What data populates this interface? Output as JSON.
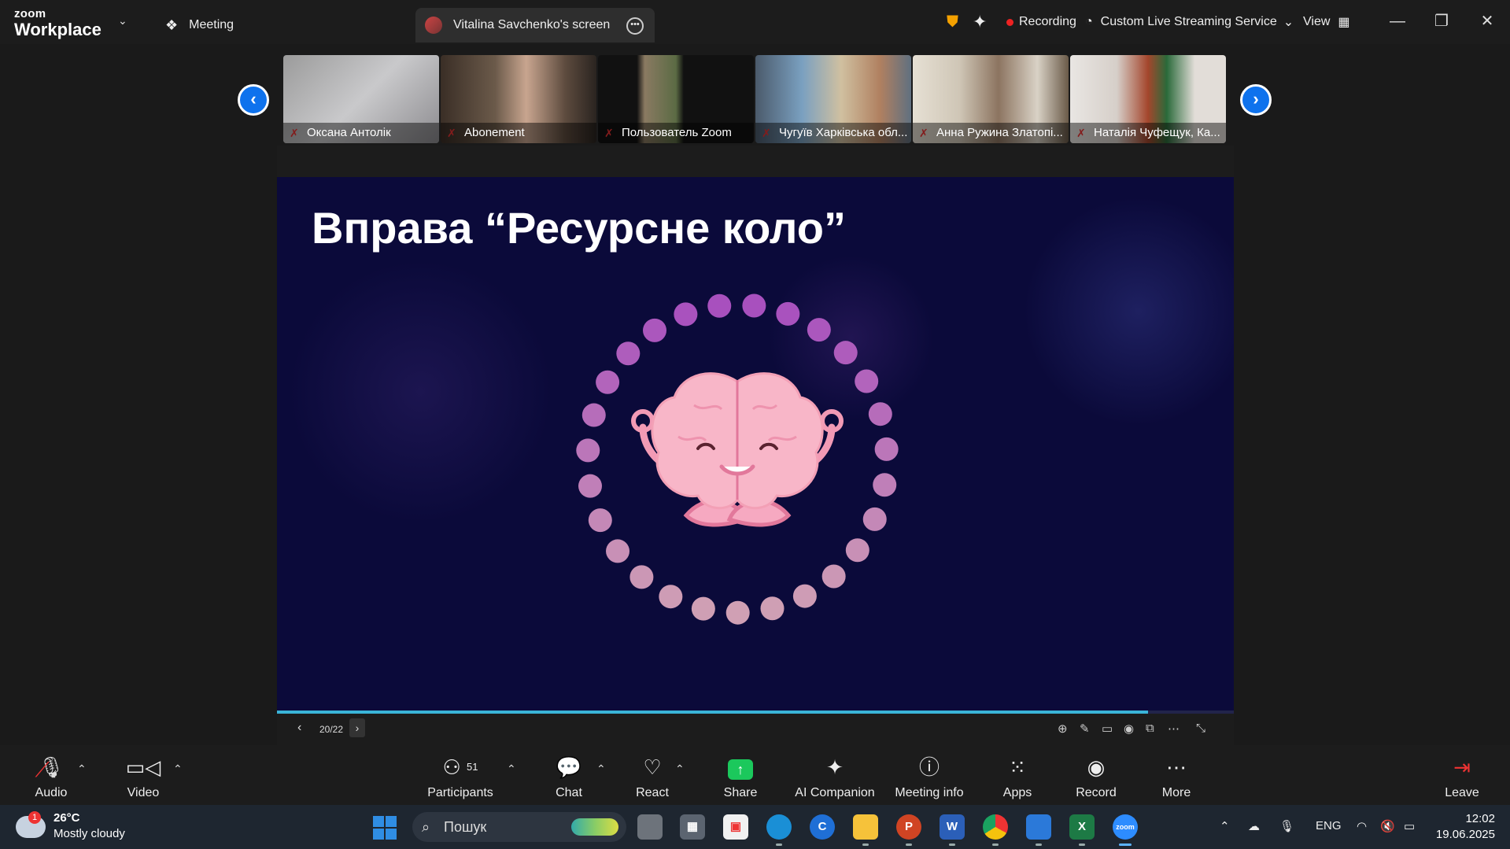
{
  "titlebar": {
    "logo_line1": "zoom",
    "logo_line2": "Workplace",
    "meeting_tab": "Meeting",
    "screen_tab": "Vitalina Savchenko's screen",
    "recording": "Recording",
    "streaming": "Custom Live Streaming Service",
    "view": "View"
  },
  "participants_strip": [
    {
      "name": "Оксана Антолік"
    },
    {
      "name": "Abonement"
    },
    {
      "name": "Пользователь Zoom"
    },
    {
      "name": "Чугуїв Харківська обл..."
    },
    {
      "name": "Анна Ружина Златопі..."
    },
    {
      "name": "Наталія Чуфещук, Ка..."
    }
  ],
  "slide": {
    "title": "Вправа “Ресурсне коло”",
    "page": "20/22",
    "progress": 0.91
  },
  "toolbar": {
    "audio": "Audio",
    "video": "Video",
    "participants": "Participants",
    "participants_count": "51",
    "chat": "Chat",
    "react": "React",
    "share": "Share",
    "ai": "AI Companion",
    "info": "Meeting info",
    "apps": "Apps",
    "record": "Record",
    "more": "More",
    "leave": "Leave"
  },
  "taskbar": {
    "temp": "26°C",
    "weather": "Mostly cloudy",
    "weather_badge": "1",
    "search": "Пошук",
    "lang": "ENG",
    "time": "12:02",
    "date": "19.06.2025"
  },
  "colors": {
    "accent": "#0e72ed",
    "slide_bg": "#0b0a3a",
    "share_green": "#1bc85c",
    "leave_red": "#e33333"
  }
}
